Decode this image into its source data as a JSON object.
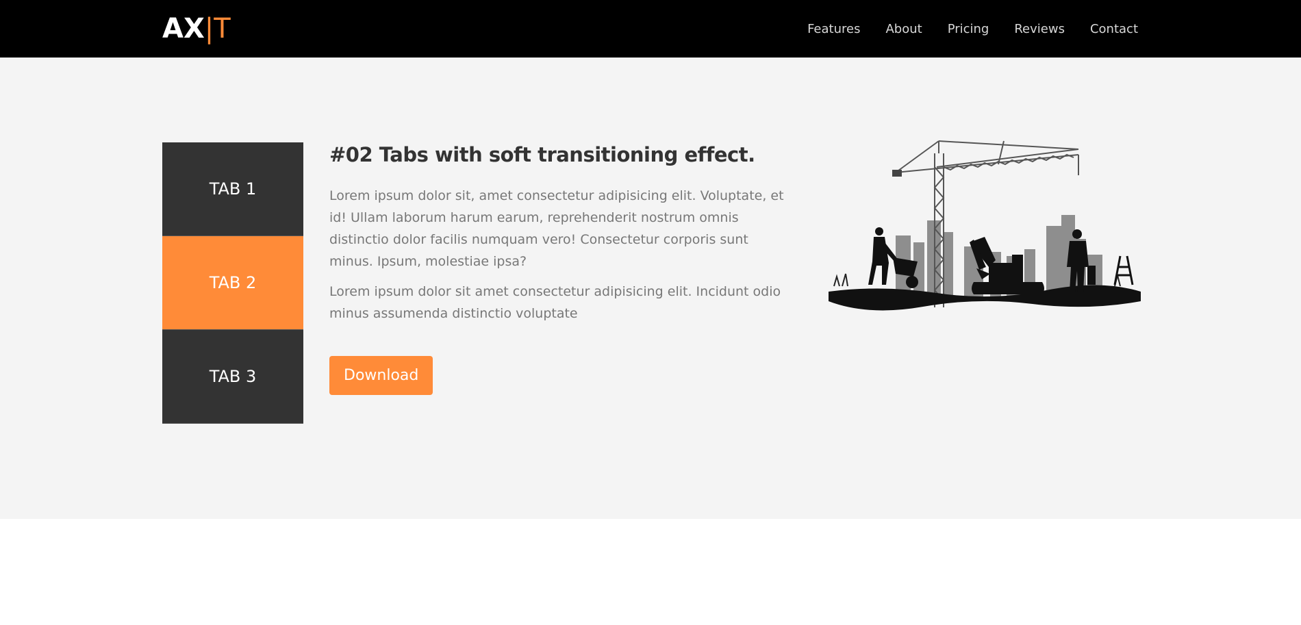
{
  "header": {
    "logo_main": "AX",
    "logo_separator": "|",
    "logo_accent": "T",
    "nav": [
      "Features",
      "About",
      "Pricing",
      "Reviews",
      "Contact"
    ]
  },
  "tabs": [
    "TAB 1",
    "TAB 2",
    "TAB 3"
  ],
  "active_tab": "TAB 2",
  "content": {
    "title": "#02 Tabs with soft transitioning effect.",
    "paragraph1": "Lorem ipsum dolor sit, amet consectetur adipisicing elit. Voluptate, et id! Ullam laborum harum earum, reprehenderit nostrum omnis distinctio dolor facilis numquam vero! Consectetur corporis sunt minus. Ipsum, molestiae ipsa?",
    "paragraph2": "Lorem ipsum dolor sit amet consectetur adipisicing elit. Incidunt odio minus assumenda distinctio voluptate",
    "button_label": "Download"
  },
  "illustration": {
    "icon": "construction-site-illustration"
  },
  "colors": {
    "accent": "#ff8b38",
    "navbar": "#000000",
    "tab_inactive": "#333333",
    "section_bg": "#f4f4f4"
  }
}
